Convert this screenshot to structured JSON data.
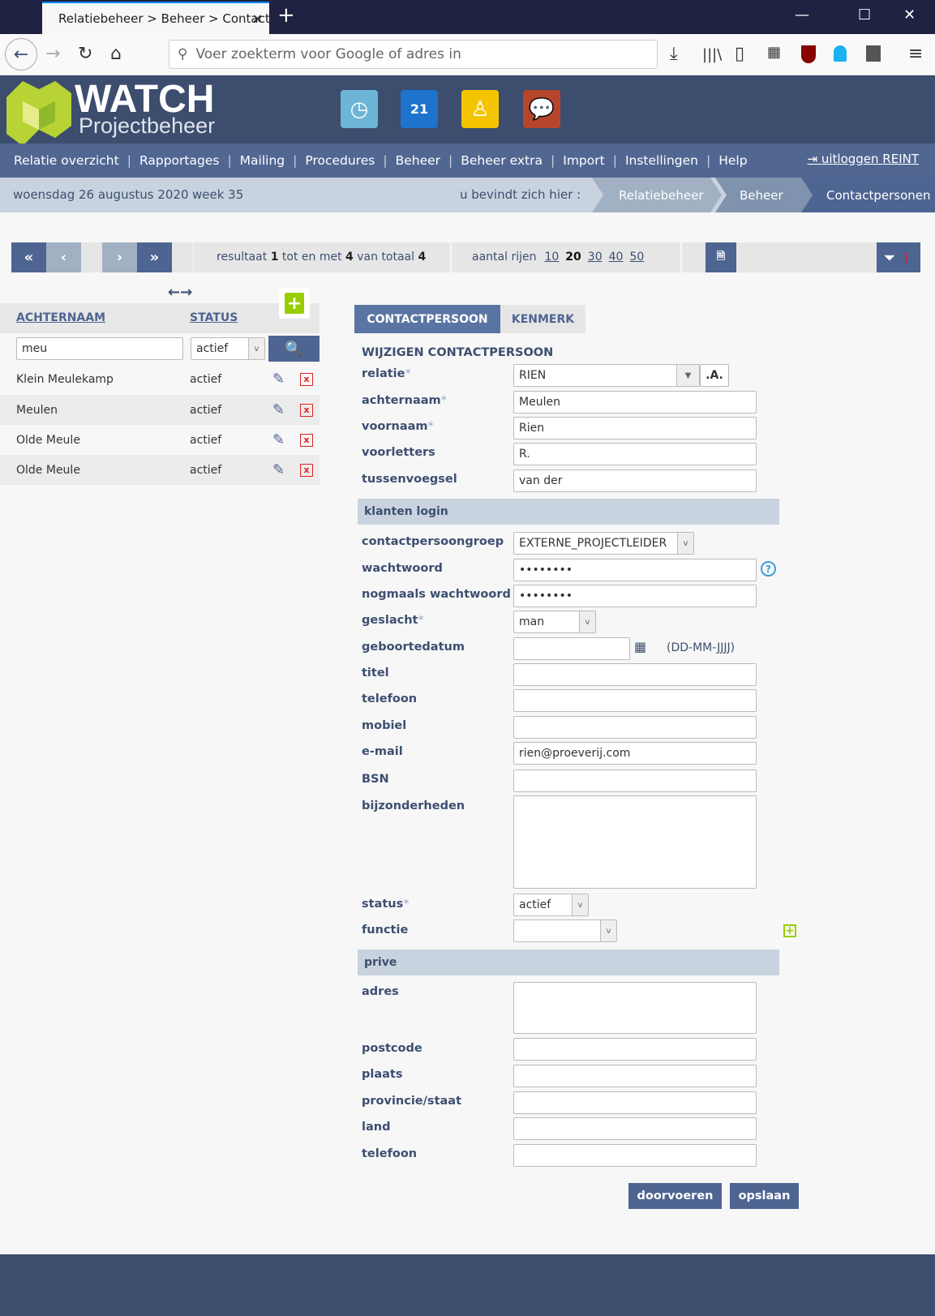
{
  "browser": {
    "tab_title": "Relatiebeheer > Beheer > Contactpersonen",
    "url_placeholder": "Voer zoekterm voor Google of adres in"
  },
  "app": {
    "logo_title": "WATCH",
    "logo_subtitle": "Projectbeheer",
    "app_icons": [
      "clock-icon",
      "calendar-icon",
      "people-icon",
      "chat-icon"
    ],
    "calendar_day": "21"
  },
  "menu": {
    "items": [
      "Relatie overzicht",
      "Rapportages",
      "Mailing",
      "Procedures",
      "Beheer",
      "Beheer extra",
      "Import",
      "Instellingen",
      "Help"
    ],
    "logout": "uitloggen REINT"
  },
  "infobar": {
    "date": "woensdag 26 augustus 2020",
    "week": "week 35",
    "here": "u bevindt zich hier :",
    "crumbs": [
      "Relatiebeheer",
      "Beheer",
      "Contactpersonen"
    ]
  },
  "toolbar": {
    "first": "«",
    "prev": "‹",
    "next": "›",
    "last": "»",
    "result_pre": "resultaat",
    "from": "1",
    "mid": "tot en met",
    "to": "4",
    "total_pre": "van totaal",
    "total": "4",
    "rows_label": "aantal rijen",
    "row_options": [
      "10",
      "20",
      "30",
      "40",
      "50"
    ],
    "row_selected": "20"
  },
  "list": {
    "col_name": "ACHTERNAAM",
    "col_status": "STATUS",
    "search_value": "meu",
    "status_filter": "actief",
    "rows": [
      {
        "name": "Klein Meulekamp",
        "status": "actief"
      },
      {
        "name": "Meulen",
        "status": "actief"
      },
      {
        "name": "Olde Meule",
        "status": "actief"
      },
      {
        "name": "Olde Meule",
        "status": "actief"
      }
    ]
  },
  "form": {
    "tabs": [
      "CONTACTPERSOON",
      "KENMERK"
    ],
    "active_tab": "CONTACTPERSOON",
    "title": "WIJZIGEN CONTACTPERSOON",
    "relatie_label": "relatie",
    "relatie_value": "RIEN",
    "relatie_btn": ".A.",
    "achternaam_label": "achternaam",
    "achternaam_value": "Meulen",
    "voornaam_label": "voornaam",
    "voornaam_value": "Rien",
    "voorletters_label": "voorletters",
    "voorletters_value": "R.",
    "tussenvoegsel_label": "tussenvoegsel",
    "tussenvoegsel_value": "van der",
    "section_login": "klanten login",
    "groep_label": "contactpersoongroep",
    "groep_value": "EXTERNE_PROJECTLEIDER",
    "wachtwoord_label": "wachtwoord",
    "wachtwoord_value": "••••••••",
    "wachtwoord2_label": "nogmaals wachtwoord",
    "wachtwoord2_value": "••••••••",
    "geslacht_label": "geslacht",
    "geslacht_value": "man",
    "geboortedatum_label": "geboortedatum",
    "date_format": "(DD-MM-JJJJ)",
    "titel_label": "titel",
    "telefoon_label": "telefoon",
    "mobiel_label": "mobiel",
    "email_label": "e-mail",
    "email_value": "rien@proeverij.com",
    "bsn_label": "BSN",
    "bijzonderheden_label": "bijzonderheden",
    "status_label": "status",
    "status_value": "actief",
    "functie_label": "functie",
    "section_prive": "prive",
    "adres_label": "adres",
    "postcode_label": "postcode",
    "plaats_label": "plaats",
    "provincie_label": "provincie/staat",
    "land_label": "land",
    "prive_telefoon_label": "telefoon",
    "req": "*",
    "btn_doorvoeren": "doorvoeren",
    "btn_opslaan": "opslaan"
  },
  "colors": {
    "header": "#3c4d6e",
    "menu": "#516792",
    "accent": "#4e6491",
    "green": "#9acd00",
    "delete": "#e02020"
  }
}
